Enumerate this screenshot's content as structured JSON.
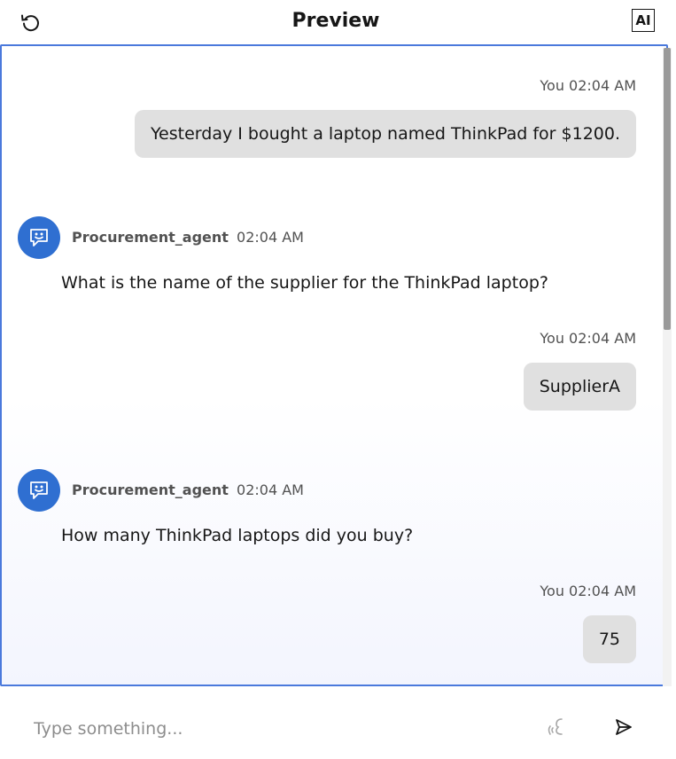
{
  "header": {
    "title": "Preview",
    "ai_badge": "AI",
    "reset_icon": "reset-arrow-icon"
  },
  "messages": [
    {
      "sender": "You",
      "time": "02:04 AM",
      "text": "Yesterday I bought a laptop named ThinkPad for $1200."
    },
    {
      "sender": "Procurement_agent",
      "time": "02:04 AM",
      "text": "What is the name of the supplier for the ThinkPad laptop?"
    },
    {
      "sender": "You",
      "time": "02:04 AM",
      "text": "SupplierA"
    },
    {
      "sender": "Procurement_agent",
      "time": "02:04 AM",
      "text": "How many ThinkPad laptops did you buy?"
    },
    {
      "sender": "You",
      "time": "02:04 AM",
      "text": "75"
    }
  ],
  "composer": {
    "placeholder": "Type something...",
    "voice_icon": "microphone-icon",
    "send_icon": "send-icon"
  },
  "colors": {
    "accent": "#4a79dc",
    "avatar": "#2f6fd1",
    "bubble": "#e0e0e0"
  }
}
